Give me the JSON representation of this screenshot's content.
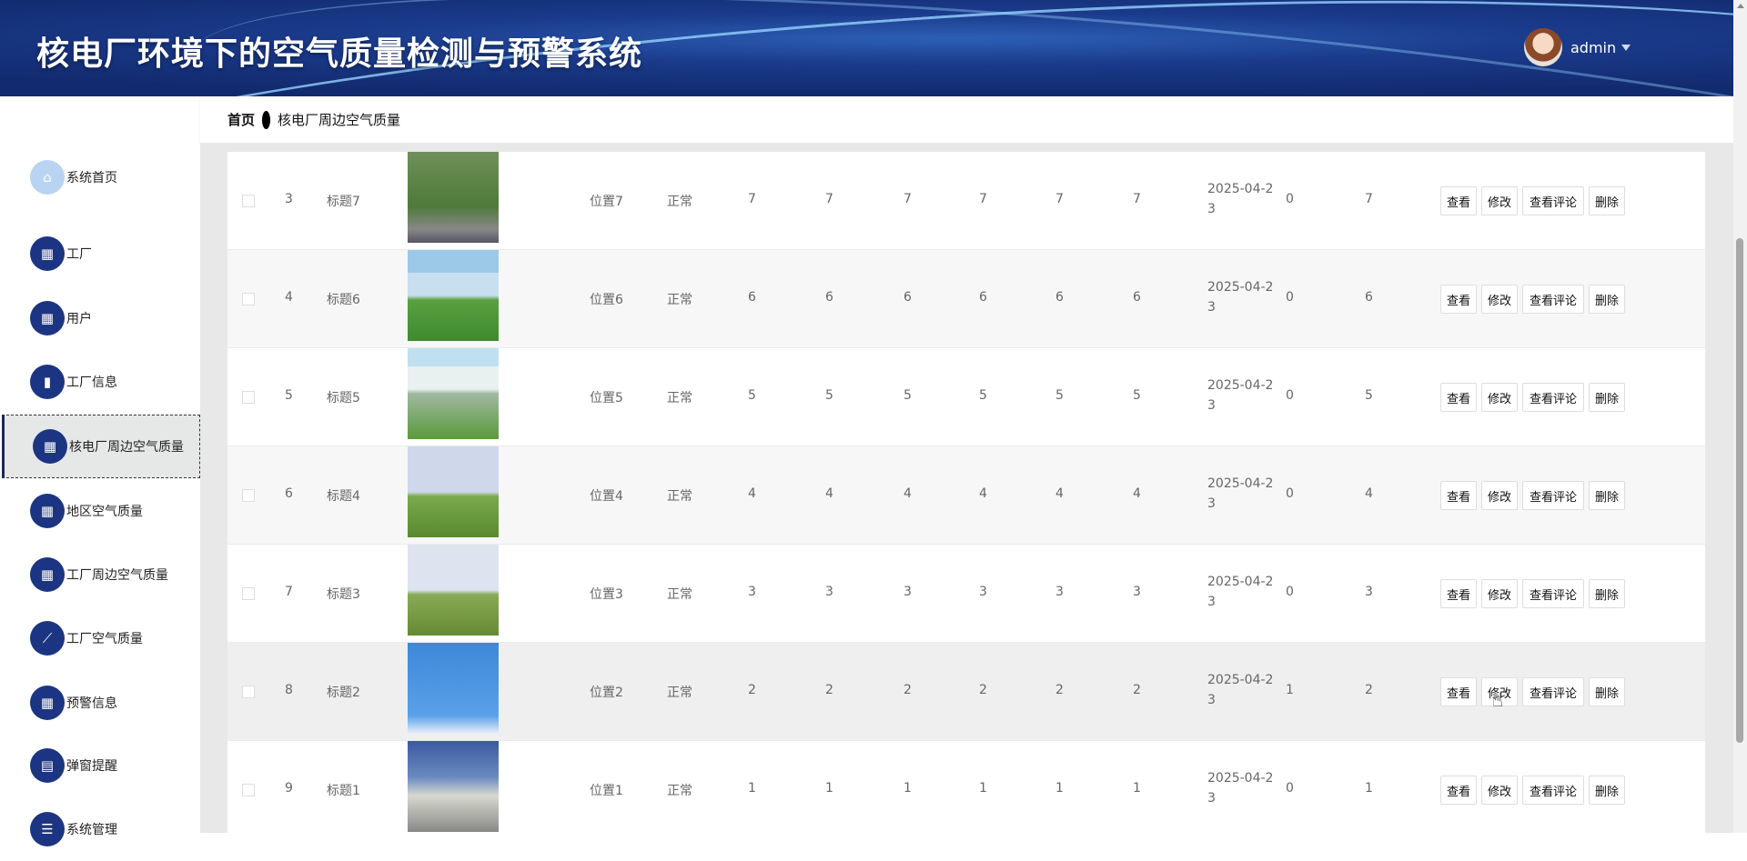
{
  "header": {
    "title": "核电厂环境下的空气质量检测与预警系统",
    "username": "admin"
  },
  "breadcrumb": {
    "home": "首页",
    "current": "核电厂周边空气质量"
  },
  "sidebar": {
    "items": [
      {
        "label": "系统首页",
        "icon": "home-icon"
      },
      {
        "label": "工厂",
        "icon": "grid-icon"
      },
      {
        "label": "用户",
        "icon": "grid-icon"
      },
      {
        "label": "工厂信息",
        "icon": "bar-chart-icon"
      },
      {
        "label": "核电厂周边空气质量",
        "icon": "table-icon",
        "active": true
      },
      {
        "label": "地区空气质量",
        "icon": "grid-icon"
      },
      {
        "label": "工厂周边空气质量",
        "icon": "grid-icon"
      },
      {
        "label": "工厂空气质量",
        "icon": "line-chart-icon"
      },
      {
        "label": "预警信息",
        "icon": "grid-icon"
      },
      {
        "label": "弹窗提醒",
        "icon": "clipboard-icon"
      },
      {
        "label": "系统管理",
        "icon": "list-icon"
      }
    ]
  },
  "buttons": {
    "view": "查看",
    "edit": "修改",
    "comments": "查看评论",
    "delete": "删除"
  },
  "rows": [
    {
      "idx": "3",
      "title": "标题7",
      "position": "位置7",
      "status": "正常",
      "v": [
        "7",
        "7",
        "7",
        "7",
        "7",
        "7"
      ],
      "date": "2025-04-23",
      "count": "0",
      "last": "7"
    },
    {
      "idx": "4",
      "title": "标题6",
      "position": "位置6",
      "status": "正常",
      "v": [
        "6",
        "6",
        "6",
        "6",
        "6",
        "6"
      ],
      "date": "2025-04-23",
      "count": "0",
      "last": "6"
    },
    {
      "idx": "5",
      "title": "标题5",
      "position": "位置5",
      "status": "正常",
      "v": [
        "5",
        "5",
        "5",
        "5",
        "5",
        "5"
      ],
      "date": "2025-04-23",
      "count": "0",
      "last": "5"
    },
    {
      "idx": "6",
      "title": "标题4",
      "position": "位置4",
      "status": "正常",
      "v": [
        "4",
        "4",
        "4",
        "4",
        "4",
        "4"
      ],
      "date": "2025-04-23",
      "count": "0",
      "last": "4"
    },
    {
      "idx": "7",
      "title": "标题3",
      "position": "位置3",
      "status": "正常",
      "v": [
        "3",
        "3",
        "3",
        "3",
        "3",
        "3"
      ],
      "date": "2025-04-23",
      "count": "0",
      "last": "3"
    },
    {
      "idx": "8",
      "title": "标题2",
      "position": "位置2",
      "status": "正常",
      "v": [
        "2",
        "2",
        "2",
        "2",
        "2",
        "2"
      ],
      "date": "2025-04-23",
      "count": "1",
      "last": "2"
    },
    {
      "idx": "9",
      "title": "标题1",
      "position": "位置1",
      "status": "正常",
      "v": [
        "1",
        "1",
        "1",
        "1",
        "1",
        "1"
      ],
      "date": "2025-04-23",
      "count": "0",
      "last": "1"
    }
  ]
}
